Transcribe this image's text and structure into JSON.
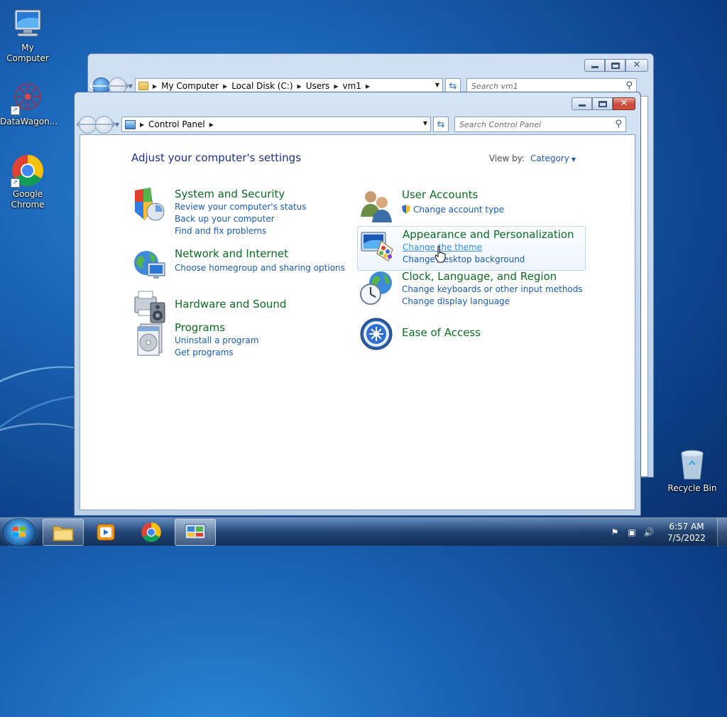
{
  "desktop": {
    "icons": [
      {
        "label": "My Computer",
        "icon": "computer-icon"
      },
      {
        "label": "DataWagon...",
        "icon": "datawagon-icon"
      },
      {
        "label": "Google Chrome",
        "icon": "chrome-icon"
      },
      {
        "label": "Recycle Bin",
        "icon": "recycle-bin-icon"
      }
    ]
  },
  "explorer_window": {
    "breadcrumbs": [
      "My Computer",
      "Local Disk (C:)",
      "Users",
      "vm1"
    ],
    "search_placeholder": "Search vm1"
  },
  "control_panel_window": {
    "breadcrumbs": [
      "Control Panel"
    ],
    "search_placeholder": "Search Control Panel",
    "heading": "Adjust your computer's settings",
    "view_by_label": "View by:",
    "view_by_value": "Category",
    "categories_left": [
      {
        "title": "System and Security",
        "icon": "shield-icon",
        "links": [
          "Review your computer's status",
          "Back up your computer",
          "Find and fix problems"
        ]
      },
      {
        "title": "Network and Internet",
        "icon": "network-globe-icon",
        "links": [
          "Choose homegroup and sharing options"
        ]
      },
      {
        "title": "Hardware and Sound",
        "icon": "printer-speaker-icon",
        "links": []
      },
      {
        "title": "Programs",
        "icon": "programs-disc-icon",
        "links": [
          "Uninstall a program",
          "Get programs"
        ]
      }
    ],
    "categories_right": [
      {
        "title": "User Accounts",
        "icon": "users-icon",
        "links": [
          "Change account type"
        ]
      },
      {
        "title": "Appearance and Personalization",
        "icon": "monitor-palette-icon",
        "links": [
          "Change the theme",
          "Change desktop background"
        ]
      },
      {
        "title": "Clock, Language, and Region",
        "icon": "clock-globe-icon",
        "links": [
          "Change keyboards or other input methods",
          "Change display language"
        ]
      },
      {
        "title": "Ease of Access",
        "icon": "ease-of-access-icon",
        "links": []
      }
    ]
  },
  "taskbar": {
    "items": [
      "start-button",
      "explorer",
      "media-player",
      "chrome",
      "control-panel"
    ],
    "clock_time": "6:57 AM",
    "clock_date": "7/5/2022"
  },
  "colors": {
    "category_title": "#0e6b24",
    "link": "#1a5cb0",
    "heading": "#1e3287"
  }
}
